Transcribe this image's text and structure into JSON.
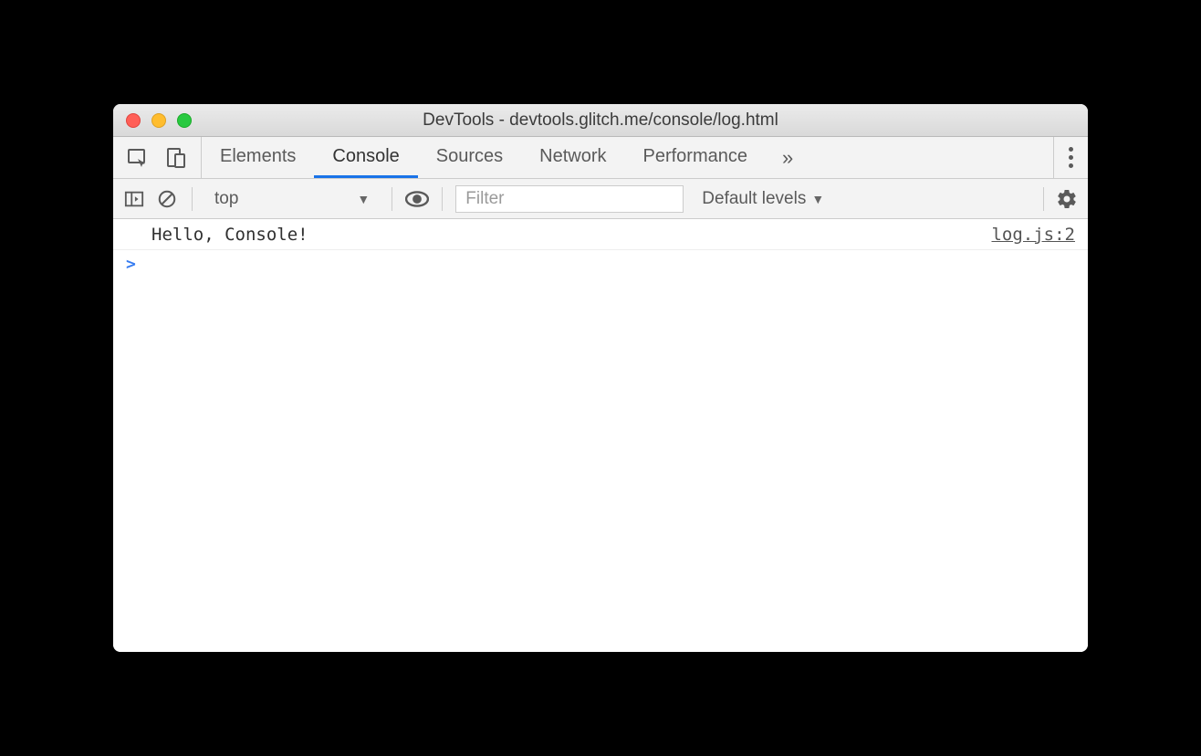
{
  "window": {
    "title": "DevTools - devtools.glitch.me/console/log.html"
  },
  "tabs": {
    "items": [
      "Elements",
      "Console",
      "Sources",
      "Network",
      "Performance"
    ],
    "active": "Console",
    "more_glyph": "»"
  },
  "console_toolbar": {
    "context": "top",
    "filter_placeholder": "Filter",
    "levels_label": "Default levels"
  },
  "console": {
    "logs": [
      {
        "message": "Hello, Console!",
        "source": "log.js:2"
      }
    ],
    "prompt": ">"
  }
}
